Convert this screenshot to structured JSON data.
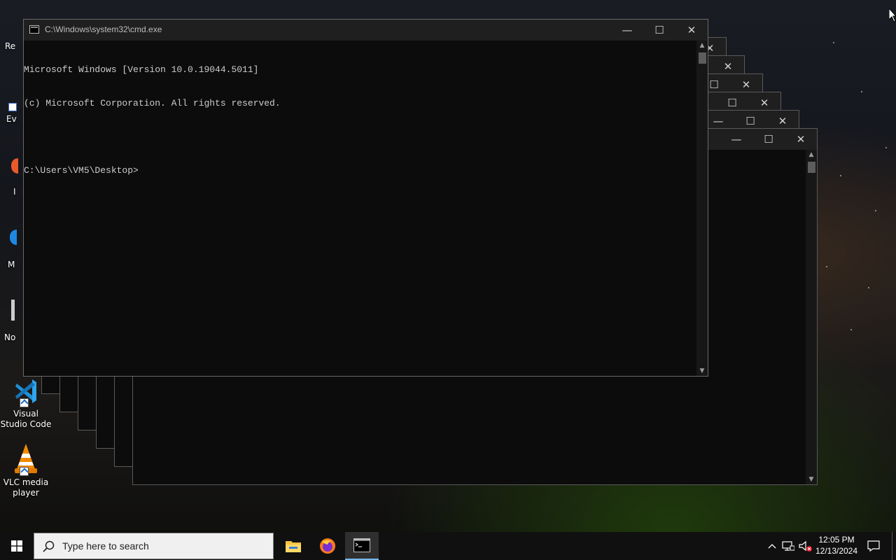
{
  "desktop": {
    "icons": [
      {
        "label": "Visual Studio Code"
      },
      {
        "label": "VLC media player"
      }
    ],
    "partial_labels": [
      "Re",
      "Ev",
      "I",
      "M",
      "No"
    ]
  },
  "cmd": {
    "title": "C:\\Windows\\system32\\cmd.exe",
    "lines": [
      "Microsoft Windows [Version 10.0.19044.5011]",
      "(c) Microsoft Corporation. All rights reserved.",
      "",
      "C:\\Users\\VM5\\Desktop>"
    ],
    "controls": {
      "minimize": "—",
      "maximize": "☐",
      "close": "✕"
    }
  },
  "taskbar": {
    "search_placeholder": "Type here to search",
    "pinned": [
      {
        "name": "file-explorer-icon"
      },
      {
        "name": "firefox-icon"
      },
      {
        "name": "cmd-icon",
        "active": true
      }
    ],
    "time": "12:05 PM",
    "date": "12/13/2024",
    "tray_icons": [
      "chevron-up-icon",
      "network-icon",
      "volume-muted-icon",
      "action-center-icon"
    ]
  },
  "colors": {
    "console_bg": "#0c0c0c",
    "console_text": "#cccccc",
    "titlebar": "#1f1f1f",
    "taskbar": "#101010",
    "search_bg": "#f0f0f0"
  }
}
